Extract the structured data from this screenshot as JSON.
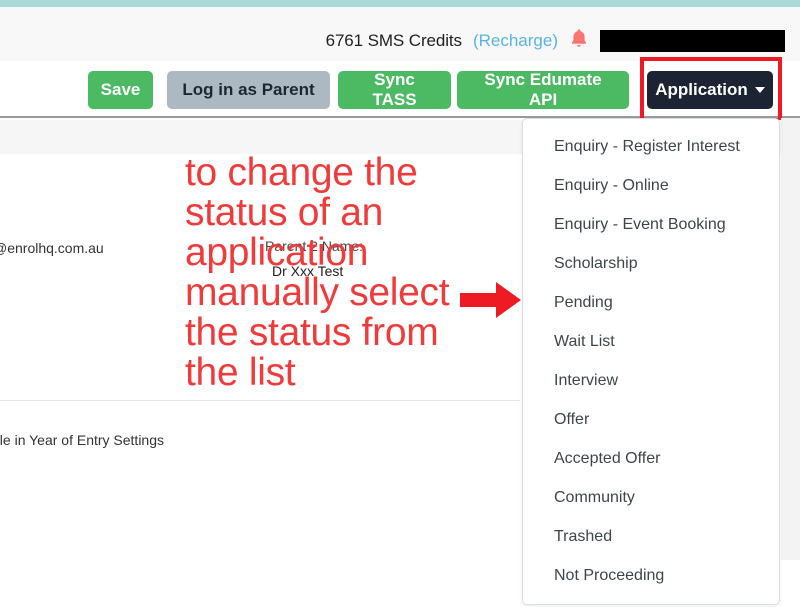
{
  "header": {
    "credits_text": "6761 SMS Credits",
    "recharge_label": "(Recharge)",
    "bell_icon": "bell-icon",
    "redacted_account": ""
  },
  "toolbar": {
    "save_label": "Save",
    "login_as_parent_label": "Log in as Parent",
    "sync_tass_label": "Sync TASS",
    "sync_edumate_label": "Sync Edumate API",
    "application_label": "Application",
    "caret_icon": "chevron-down-icon"
  },
  "content": {
    "email_label": ":",
    "email_value": "@enrolhq.com.au",
    "parent2_name_label": "Parent 2 Name:",
    "parent2_name_value": "Dr Xxx Test",
    "year_of_entry_note": "ilable in Year of Entry Settings"
  },
  "annotation": {
    "lines": [
      "to change the",
      "status of an",
      "application",
      "manually select",
      "the status from",
      "the list"
    ],
    "arrow_icon": "arrow-right-icon",
    "color": "#ef3b3b",
    "highlight_color": "#ee1b24"
  },
  "dropdown": {
    "items": [
      "Enquiry - Register Interest",
      "Enquiry - Online",
      "Enquiry - Event Booking",
      "Scholarship",
      "Pending",
      "Wait List",
      "Interview",
      "Offer",
      "Accepted Offer",
      "Community",
      "Trashed",
      "Not Proceeding"
    ]
  },
  "colors": {
    "teal_strip": "#a9d9d9",
    "green_button": "#4cb963",
    "gray_button": "#adb9c2",
    "dark_button": "#1c2333",
    "link_blue": "#5bb3e4",
    "bell_red": "#f8766f"
  }
}
